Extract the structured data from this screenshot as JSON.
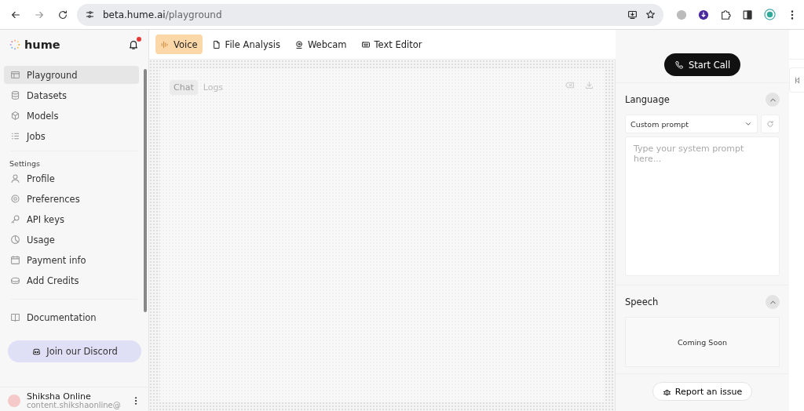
{
  "browser": {
    "url_host": "beta.hume.ai",
    "url_path": "/playground"
  },
  "sidebar": {
    "logo": "hume",
    "notification": true,
    "items": [
      {
        "label": "Playground",
        "selected": true
      },
      {
        "label": "Datasets",
        "selected": false
      },
      {
        "label": "Models",
        "selected": false
      },
      {
        "label": "Jobs",
        "selected": false
      }
    ],
    "settings_heading": "Settings",
    "settings_items": [
      {
        "label": "Profile",
        "selected": false
      },
      {
        "label": "Preferences",
        "selected": false
      },
      {
        "label": "API keys",
        "selected": false
      },
      {
        "label": "Usage",
        "selected": false
      },
      {
        "label": "Payment info",
        "selected": false
      },
      {
        "label": "Add Credits",
        "selected": false
      }
    ],
    "documentation": "Documentation",
    "discord_button": "Join our Discord",
    "user": {
      "name": "Shiksha Online",
      "email": "content.shikshaonline@"
    }
  },
  "tabs": [
    {
      "label": "Voice",
      "selected": true
    },
    {
      "label": "File Analysis",
      "selected": false
    },
    {
      "label": "Webcam",
      "selected": false
    },
    {
      "label": "Text Editor",
      "selected": false
    }
  ],
  "chat_tabs": [
    {
      "label": "Chat",
      "selected": true
    },
    {
      "label": "Logs",
      "selected": false
    }
  ],
  "panel": {
    "start_call": "Start Call",
    "language": {
      "title": "Language",
      "expanded": true,
      "prompt_select": "Custom prompt",
      "placeholder": "Type your system prompt here..."
    },
    "speech": {
      "title": "Speech",
      "expanded": true,
      "message": "Coming Soon"
    },
    "report": "Report an issue"
  }
}
